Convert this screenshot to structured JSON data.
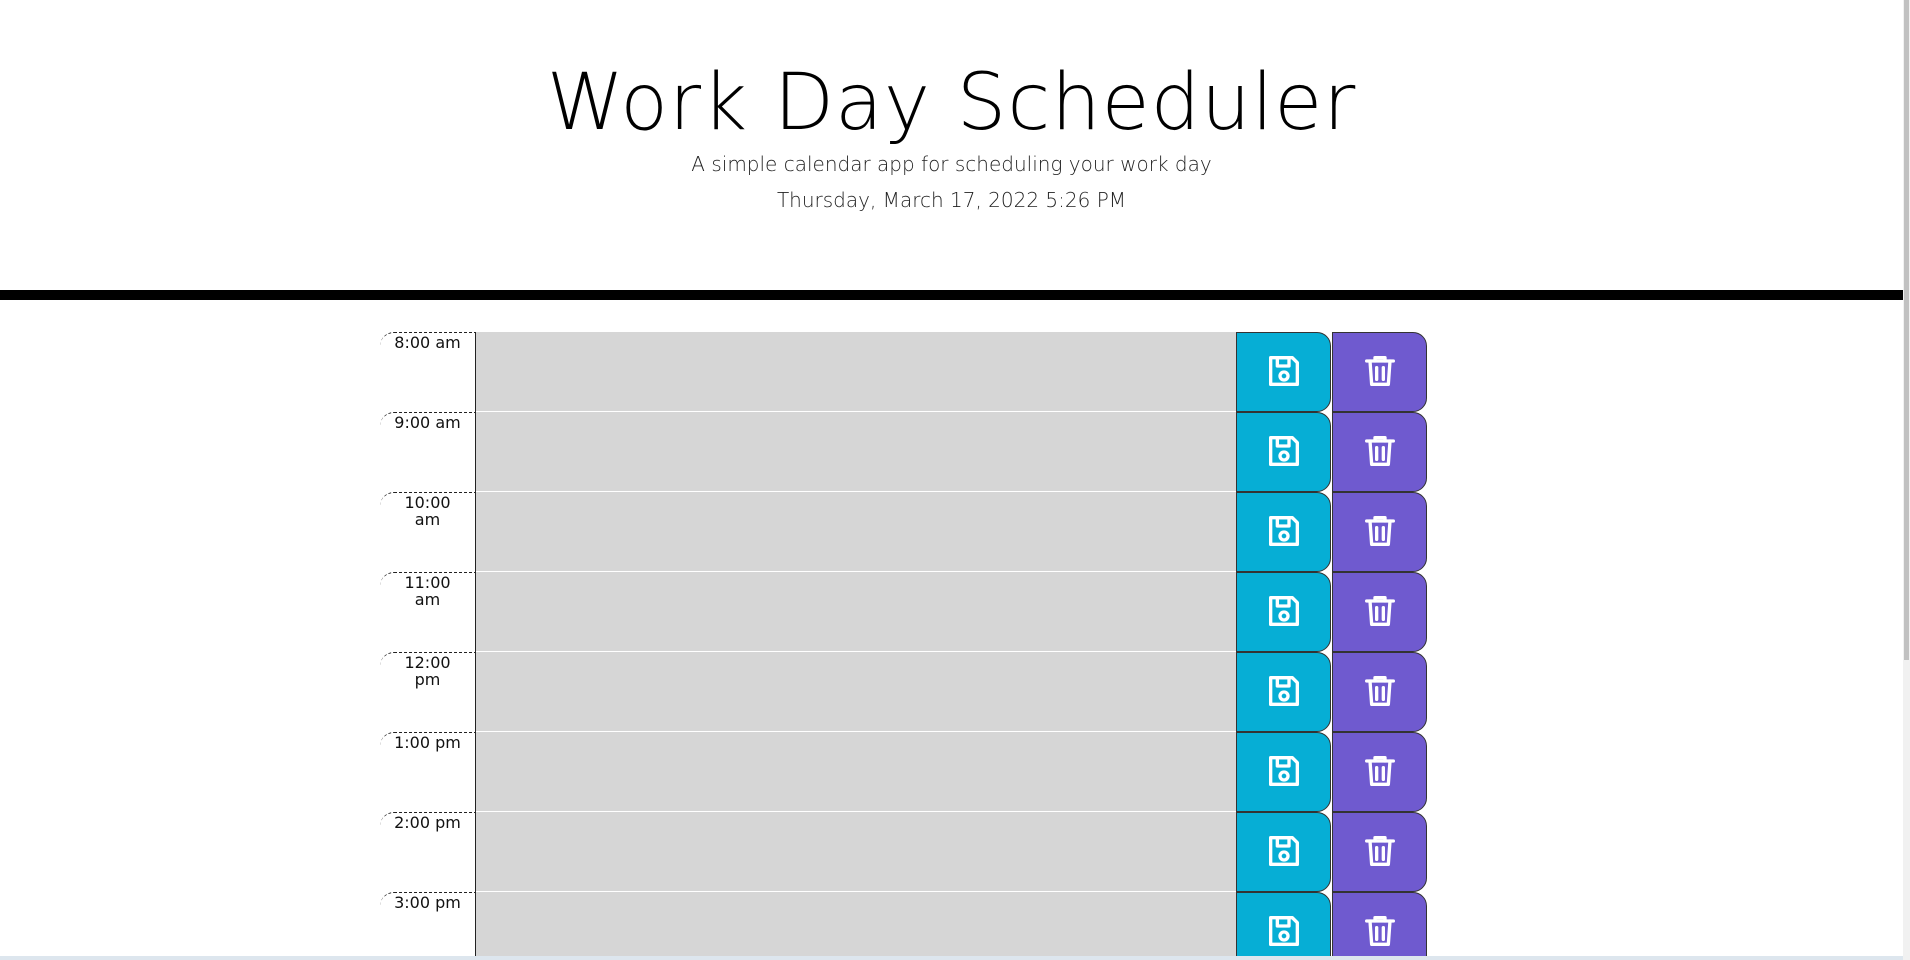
{
  "header": {
    "title": "Work Day Scheduler",
    "subtitle": "A simple calendar app for scheduling your work day",
    "current_day": "Thursday, March 17, 2022 5:26 PM"
  },
  "icons": {
    "save": "floppy-disk-icon",
    "delete": "trash-icon"
  },
  "colors": {
    "past_row": "#d6d6d6",
    "save_button": "#06aed5",
    "delete_button": "#6f5acf",
    "header_rule": "#000000"
  },
  "time_blocks": [
    {
      "hour": "8:00 am",
      "description": ""
    },
    {
      "hour": "9:00 am",
      "description": ""
    },
    {
      "hour": "10:00 am",
      "description": ""
    },
    {
      "hour": "11:00 am",
      "description": ""
    },
    {
      "hour": "12:00 pm",
      "description": ""
    },
    {
      "hour": "1:00 pm",
      "description": ""
    },
    {
      "hour": "2:00 pm",
      "description": ""
    },
    {
      "hour": "3:00 pm",
      "description": ""
    }
  ]
}
